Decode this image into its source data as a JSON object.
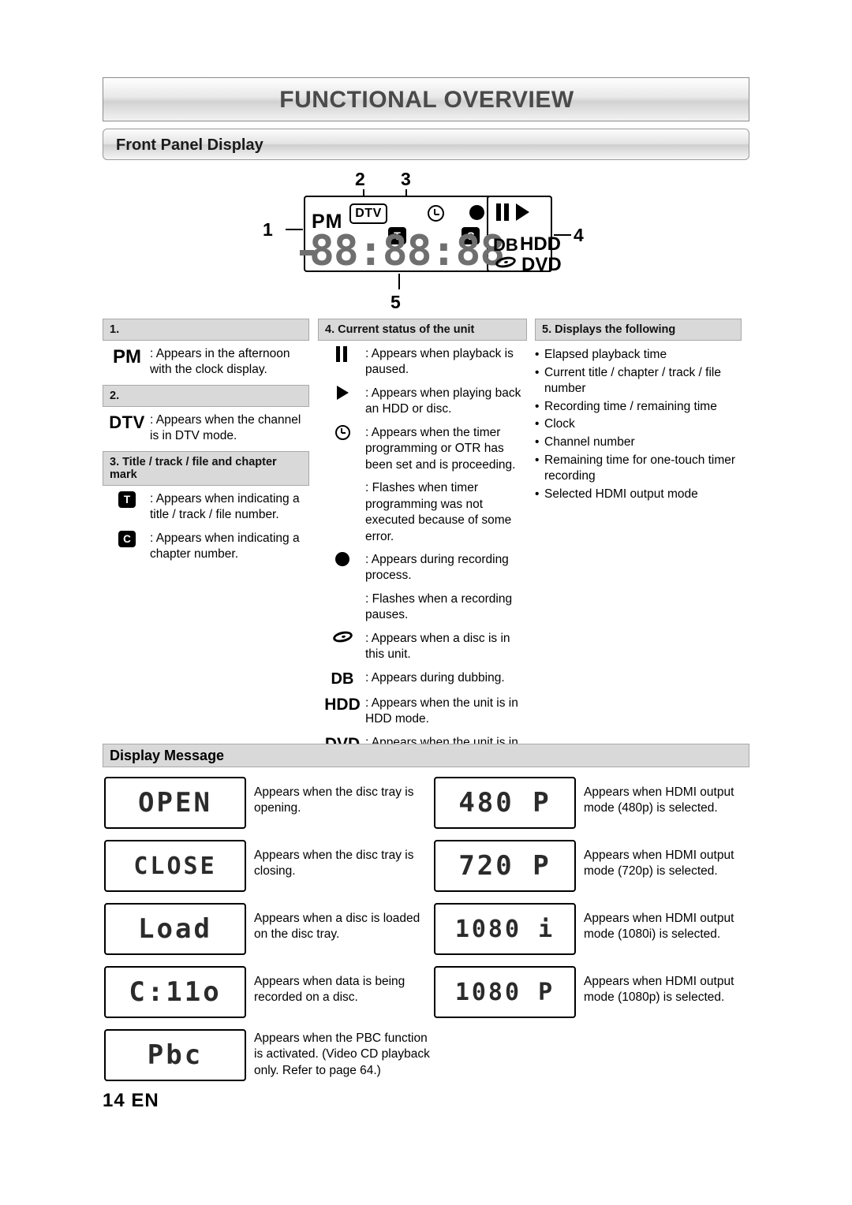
{
  "header": {
    "title": "FUNCTIONAL OVERVIEW",
    "section": "Front Panel Display"
  },
  "figure": {
    "callouts": [
      "1",
      "2",
      "3",
      "4",
      "5"
    ],
    "panel": {
      "pm": "PM",
      "dtv": "DTV",
      "t_mark": "T",
      "c_mark": "C",
      "digits": "88:88:88",
      "db": "DB",
      "hdd": "HDD",
      "dvd": "DVD"
    }
  },
  "legend": {
    "col1": {
      "bar1": "1.",
      "item1": {
        "glyph": "PM",
        "text": ": Appears in the afternoon with the clock display."
      },
      "bar2": "2.",
      "item2": {
        "glyph": "DTV",
        "text": ": Appears when the channel is in DTV mode."
      },
      "bar3": "3. Title / track / file and chapter mark",
      "item3": {
        "glyph": "T",
        "text": ": Appears when indicating a title / track / file number."
      },
      "item4": {
        "glyph": "C",
        "text": ": Appears when indicating a chapter number."
      }
    },
    "col2": {
      "bar": "4. Current status of the unit",
      "items": [
        {
          "glyph": "pause-icon",
          "text": ": Appears when playback is paused."
        },
        {
          "glyph": "play-icon",
          "text": ": Appears when playing back an HDD or disc."
        },
        {
          "glyph": "timer-icon",
          "text": ": Appears when the timer programming or OTR has been set and is proceeding."
        },
        {
          "glyph": "",
          "text": ": Flashes when timer programming was not executed because of some error."
        },
        {
          "glyph": "record-icon",
          "text": ": Appears during recording process."
        },
        {
          "glyph": "",
          "text": ": Flashes when a recording pauses."
        },
        {
          "glyph": "disc-icon",
          "text": ": Appears when a disc is in this unit."
        },
        {
          "glyph": "DB",
          "text": ": Appears during dubbing."
        },
        {
          "glyph": "HDD",
          "text": ": Appears when the unit is in HDD mode."
        },
        {
          "glyph": "DVD",
          "text": ": Appears when the unit is in DVD mode."
        }
      ]
    },
    "col3": {
      "bar": "5. Displays the following",
      "bullets": [
        "Elapsed playback time",
        "Current title / chapter / track / file number",
        "Recording time / remaining time",
        "Clock",
        "Channel number",
        "Remaining time for one-touch timer recording",
        "Selected HDMI output mode"
      ]
    }
  },
  "display_message": {
    "bar": "Display Message",
    "left": [
      {
        "lcd": "OPEN",
        "text": "Appears when the disc tray is opening."
      },
      {
        "lcd": "CLOSE",
        "text": "Appears when the disc tray is closing."
      },
      {
        "lcd": "Load",
        "text": "Appears when a disc is loaded on the disc tray."
      },
      {
        "lcd": "C:11o",
        "text": "Appears when data is being recorded on a disc."
      },
      {
        "lcd": "Pbc",
        "text": "Appears when the PBC function is activated. (Video CD playback only. Refer to page 64.)"
      }
    ],
    "right": [
      {
        "lcd": "480 P",
        "text": "Appears when HDMI output mode (480p) is selected."
      },
      {
        "lcd": "720 P",
        "text": "Appears when HDMI output mode (720p) is selected."
      },
      {
        "lcd": "1080 i",
        "text": "Appears when HDMI output mode (1080i) is selected."
      },
      {
        "lcd": "1080 P",
        "text": "Appears when HDMI output mode (1080p) is selected."
      }
    ]
  },
  "footer": {
    "page": "14  EN"
  }
}
